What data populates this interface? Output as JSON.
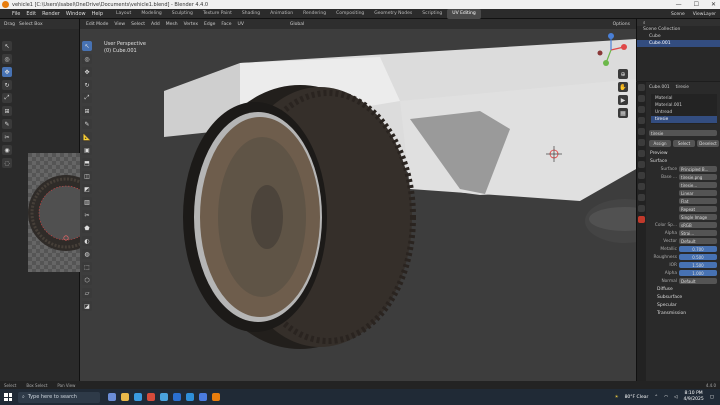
{
  "window": {
    "title": "vehicle1 [C:\\Users\\Isabel\\OneDrive\\Documents\\vehicle1.blend] - Blender 4.4.0",
    "controls": [
      "—",
      "☐",
      "✕"
    ]
  },
  "menu": [
    "File",
    "Edit",
    "Render",
    "Window",
    "Help"
  ],
  "workspaces": [
    "Layout",
    "Modeling",
    "Sculpting",
    "Texture Paint",
    "Shading",
    "Animation",
    "Rendering",
    "Compositing",
    "Geometry Nodes",
    "Scripting",
    "UV Editing"
  ],
  "active_workspace": "UV Editing",
  "topright": {
    "scene": "Scene",
    "view_layer": "ViewLayer"
  },
  "uv_editor": {
    "mode": "Drag",
    "select": "Select Box"
  },
  "viewport": {
    "mode": "Edit Mode",
    "menus": [
      "View",
      "Select",
      "Add",
      "Mesh",
      "Vertex",
      "Edge",
      "Face",
      "UV"
    ],
    "orientation": "Global",
    "info_line1": "User Perspective",
    "info_line2": "(0) Cube.001",
    "options": "Options"
  },
  "outliner": {
    "header": "Scene Collection",
    "items": [
      {
        "name": "Cube",
        "selected": false
      },
      {
        "name": "Cube.001",
        "selected": true
      }
    ]
  },
  "properties": {
    "object": "Cube.001",
    "material_name": "tiresie",
    "slots": [
      {
        "name": "Material",
        "selected": false
      },
      {
        "name": "Material.001",
        "selected": false
      },
      {
        "name": "Untread",
        "selected": false
      },
      {
        "name": "tiresie",
        "selected": true
      }
    ],
    "assign_buttons": [
      "Assign",
      "Select",
      "Deselect"
    ],
    "sections": {
      "preview": "Preview",
      "surface": "Surface"
    },
    "surface_shader": "Principled B...",
    "base_color": {
      "label": "Base ...",
      "value": "tiresie.png"
    },
    "image_rows": [
      {
        "label": "",
        "value": "tiresie..."
      },
      {
        "label": "",
        "value": "Linear"
      },
      {
        "label": "",
        "value": "Flat"
      },
      {
        "label": "",
        "value": "Repeat"
      },
      {
        "label": "",
        "value": "Single Image"
      }
    ],
    "color_space": {
      "label": "Color Sp...",
      "value": "sRGB"
    },
    "alpha_mode": {
      "label": "Alpha",
      "value": "Strai..."
    },
    "vector": {
      "label": "Vector",
      "value": "Default"
    },
    "metallic": {
      "label": "Metallic",
      "value": "0.700"
    },
    "roughness": {
      "label": "Roughness",
      "value": "0.500"
    },
    "ior": {
      "label": "IOR",
      "value": "1.500"
    },
    "alpha": {
      "label": "Alpha",
      "value": "1.000"
    },
    "normal": {
      "label": "Normal",
      "value": "Default"
    },
    "subsections": [
      "Diffuse",
      "Subsurface",
      "Specular",
      "Transmission"
    ]
  },
  "status": {
    "items": [
      "Select",
      "Box Select",
      "Pan View"
    ],
    "version": "4.4.0"
  },
  "taskbar": {
    "search_placeholder": "Type here to search",
    "weather": "80°F Clear",
    "time": "8:10 PM",
    "date": "4/9/2025"
  },
  "colors": {
    "accent": "#4772b3",
    "blender_orange": "#e87d0d",
    "material_tab": "#c1392b"
  }
}
